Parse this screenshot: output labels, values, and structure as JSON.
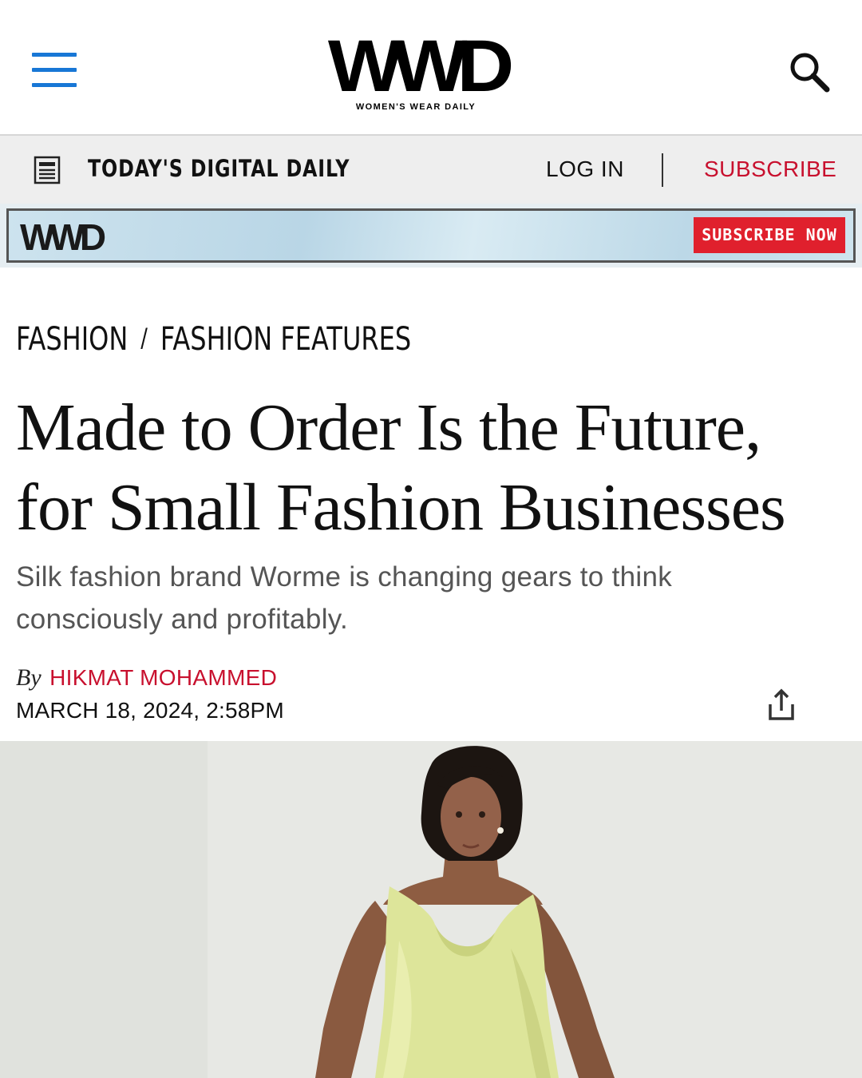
{
  "header": {
    "menu_icon": "hamburger-menu-icon",
    "logo_text": "WWD",
    "logo_tagline": "WOMEN'S WEAR DAILY",
    "search_icon": "search-icon",
    "accent_color": "#1877d6"
  },
  "daily_bar": {
    "icon": "newspaper-icon",
    "label": "TODAY'S DIGITAL DAILY",
    "login_label": "LOG IN",
    "subscribe_label": "SUBSCRIBE",
    "subscribe_color": "#c8102e"
  },
  "promo": {
    "logo_text": "WWD",
    "button_label": "SUBSCRIBE NOW",
    "button_color": "#e0202d"
  },
  "article": {
    "breadcrumb": [
      "FASHION",
      "FASHION FEATURES"
    ],
    "breadcrumb_separator": "/",
    "headline_lines": [
      "Made to Order Is the Future,",
      "for Small Fashion Businesses"
    ],
    "dek": "Silk fashion brand Worme is changing gears to think consciously and profitably.",
    "by_word": "By",
    "author": "HIKMAT MOHAMMED",
    "date": "MARCH 18, 2024, 2:58PM",
    "share_icon": "share-icon",
    "hero_image": "model-in-yellow-silk-dress-image"
  }
}
